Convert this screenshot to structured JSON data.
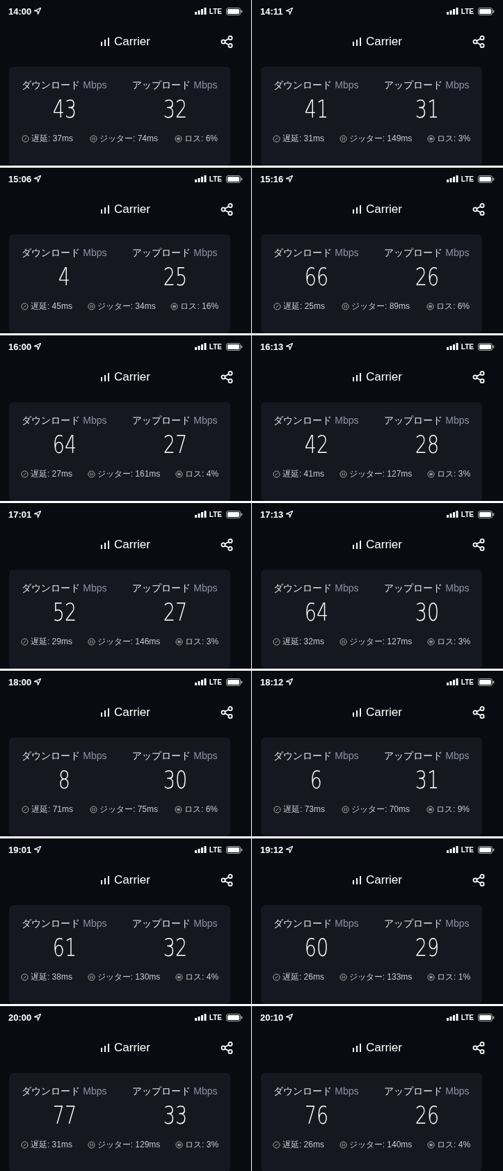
{
  "screens": [
    {
      "time": "14:00",
      "network": "LTE",
      "carrier": "Carrier",
      "download_label": "ダウンロード",
      "download_unit": "Mbps",
      "upload_label": "アップロード",
      "upload_unit": "Mbps",
      "download": "43",
      "upload": "32",
      "latency": "遅延: 37ms",
      "jitter": "ジッター: 74ms",
      "loss": "ロス: 6%"
    },
    {
      "time": "14:11",
      "network": "LTE",
      "carrier": "Carrier",
      "download_label": "ダウンロード",
      "download_unit": "Mbps",
      "upload_label": "アップロード",
      "upload_unit": "Mbps",
      "download": "41",
      "upload": "31",
      "latency": "遅延: 31ms",
      "jitter": "ジッター: 149ms",
      "loss": "ロス: 3%"
    },
    {
      "time": "15:06",
      "network": "LTE",
      "carrier": "Carrier",
      "download_label": "ダウンロード",
      "download_unit": "Mbps",
      "upload_label": "アップロード",
      "upload_unit": "Mbps",
      "download": "4",
      "upload": "25",
      "latency": "遅延: 45ms",
      "jitter": "ジッター: 34ms",
      "loss": "ロス: 16%"
    },
    {
      "time": "15:16",
      "network": "LTE",
      "carrier": "Carrier",
      "download_label": "ダウンロード",
      "download_unit": "Mbps",
      "upload_label": "アップロード",
      "upload_unit": "Mbps",
      "download": "66",
      "upload": "26",
      "latency": "遅延: 25ms",
      "jitter": "ジッター: 89ms",
      "loss": "ロス: 6%"
    },
    {
      "time": "16:00",
      "network": "LTE",
      "carrier": "Carrier",
      "download_label": "ダウンロード",
      "download_unit": "Mbps",
      "upload_label": "アップロード",
      "upload_unit": "Mbps",
      "download": "64",
      "upload": "27",
      "latency": "遅延: 27ms",
      "jitter": "ジッター: 161ms",
      "loss": "ロス: 4%"
    },
    {
      "time": "16:13",
      "network": "LTE",
      "carrier": "Carrier",
      "download_label": "ダウンロード",
      "download_unit": "Mbps",
      "upload_label": "アップロード",
      "upload_unit": "Mbps",
      "download": "42",
      "upload": "28",
      "latency": "遅延: 41ms",
      "jitter": "ジッター: 127ms",
      "loss": "ロス: 3%"
    },
    {
      "time": "17:01",
      "network": "LTE",
      "carrier": "Carrier",
      "download_label": "ダウンロード",
      "download_unit": "Mbps",
      "upload_label": "アップロード",
      "upload_unit": "Mbps",
      "download": "52",
      "upload": "27",
      "latency": "遅延: 29ms",
      "jitter": "ジッター: 146ms",
      "loss": "ロス: 3%"
    },
    {
      "time": "17:13",
      "network": "LTE",
      "carrier": "Carrier",
      "download_label": "ダウンロード",
      "download_unit": "Mbps",
      "upload_label": "アップロード",
      "upload_unit": "Mbps",
      "download": "64",
      "upload": "30",
      "latency": "遅延: 32ms",
      "jitter": "ジッター: 127ms",
      "loss": "ロス: 3%"
    },
    {
      "time": "18:00",
      "network": "LTE",
      "carrier": "Carrier",
      "download_label": "ダウンロード",
      "download_unit": "Mbps",
      "upload_label": "アップロード",
      "upload_unit": "Mbps",
      "download": "8",
      "upload": "30",
      "latency": "遅延: 71ms",
      "jitter": "ジッター: 75ms",
      "loss": "ロス: 6%"
    },
    {
      "time": "18:12",
      "network": "LTE",
      "carrier": "Carrier",
      "download_label": "ダウンロード",
      "download_unit": "Mbps",
      "upload_label": "アップロード",
      "upload_unit": "Mbps",
      "download": "6",
      "upload": "31",
      "latency": "遅延: 73ms",
      "jitter": "ジッター: 70ms",
      "loss": "ロス: 9%"
    },
    {
      "time": "19:01",
      "network": "LTE",
      "carrier": "Carrier",
      "download_label": "ダウンロード",
      "download_unit": "Mbps",
      "upload_label": "アップロード",
      "upload_unit": "Mbps",
      "download": "61",
      "upload": "32",
      "latency": "遅延: 38ms",
      "jitter": "ジッター: 130ms",
      "loss": "ロス: 4%"
    },
    {
      "time": "19:12",
      "network": "LTE",
      "carrier": "Carrier",
      "download_label": "ダウンロード",
      "download_unit": "Mbps",
      "upload_label": "アップロード",
      "upload_unit": "Mbps",
      "download": "60",
      "upload": "29",
      "latency": "遅延: 26ms",
      "jitter": "ジッター: 133ms",
      "loss": "ロス: 1%"
    },
    {
      "time": "20:00",
      "network": "LTE",
      "carrier": "Carrier",
      "download_label": "ダウンロード",
      "download_unit": "Mbps",
      "upload_label": "アップロード",
      "upload_unit": "Mbps",
      "download": "77",
      "upload": "33",
      "latency": "遅延: 31ms",
      "jitter": "ジッター: 129ms",
      "loss": "ロス: 3%"
    },
    {
      "time": "20:10",
      "network": "LTE",
      "carrier": "Carrier",
      "download_label": "ダウンロード",
      "download_unit": "Mbps",
      "upload_label": "アップロード",
      "upload_unit": "Mbps",
      "download": "76",
      "upload": "26",
      "latency": "遅延: 26ms",
      "jitter": "ジッター: 140ms",
      "loss": "ロス: 4%"
    }
  ]
}
